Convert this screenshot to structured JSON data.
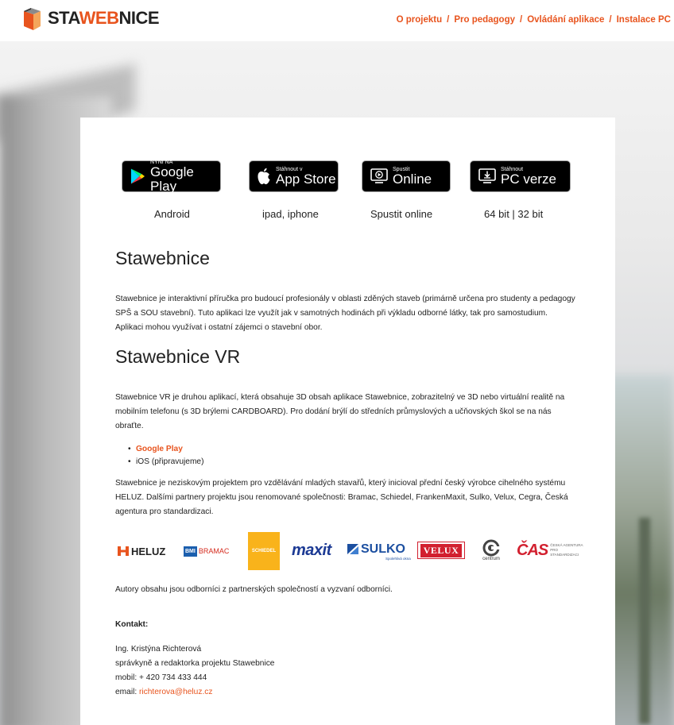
{
  "header": {
    "logo": {
      "part1": "STA",
      "part2": "WEB",
      "part3": "NICE"
    },
    "nav": [
      {
        "label": "O projektu"
      },
      {
        "label": "Pro pedagogy"
      },
      {
        "label": "Ovládání aplikace"
      },
      {
        "label": "Instalace PC"
      }
    ],
    "separator": "/"
  },
  "badges": [
    {
      "small": "NYNÍ NA",
      "big": "Google Play",
      "label": "Android"
    },
    {
      "small": "Stáhnout v",
      "big": "App Store",
      "label": "ipad, iphone"
    },
    {
      "small": "Spustit",
      "big": "Online",
      "label": "Spustit online"
    },
    {
      "small": "Stáhnout",
      "big": "PC verze",
      "label": "64 bit | 32 bit"
    }
  ],
  "section1": {
    "title": "Stawebnice",
    "text": "Stawebnice je interaktivní příručka pro budoucí profesionály v oblasti zděných staveb (primárně určena pro studenty a pedagogy SPŠ a SOU stavební). Tuto aplikaci lze využít jak v samotných hodinách při výkladu odborné látky, tak pro samostudium. Aplikaci mohou využívat i ostatní zájemci o stavební obor."
  },
  "section2": {
    "title": "Stawebnice VR",
    "text": "Stawebnice VR je druhou aplikací, která obsahuje 3D obsah aplikace Stawebnice, zobrazitelný ve 3D nebo virtuální realitě na mobilním telefonu (s 3D brýlemi CARDBOARD). Pro dodání brýlí do středních průmyslových a učňovských škol se na nás obraťte.",
    "links": [
      {
        "label": "Google Play"
      },
      {
        "label": "iOS (připravujeme)"
      }
    ],
    "text2": "Stawebnice je neziskovým projektem pro vzdělávání mladých stavařů, který inicioval přední český výrobce cihelného systému HELUZ. Dalšími partnery projektu jsou renomované společnosti: Bramac, Schiedel, FrankenMaxit, Sulko, Velux, Cegra, Česká agentura pro standardizaci."
  },
  "partners": {
    "heluz": "HELUZ",
    "bmi": "BMI",
    "bramac": "BRAMAC",
    "schiedel": "SCHIEDEL",
    "maxit": "maxit",
    "sulko": "SULKO",
    "sulko_sub": "Spolehlivá okna",
    "velux": "VELUX",
    "centrum": "centrum",
    "cas": "ČAS",
    "cas_text": "ČESKÁ AGENTURA PRO STANDARDIZACI"
  },
  "authors": "Autory obsahu jsou odborníci z partnerských společností a vyzvaní odborníci.",
  "contact": {
    "heading": "Kontakt:",
    "name": "Ing. Kristýna Richterová",
    "role": "správkyně a redaktorka projektu Stawebnice",
    "phone": "mobil: + 420 734 433 444",
    "email_label": "email: ",
    "email": "richterova@heluz.cz"
  },
  "colors": {
    "accent": "#e8541e"
  }
}
